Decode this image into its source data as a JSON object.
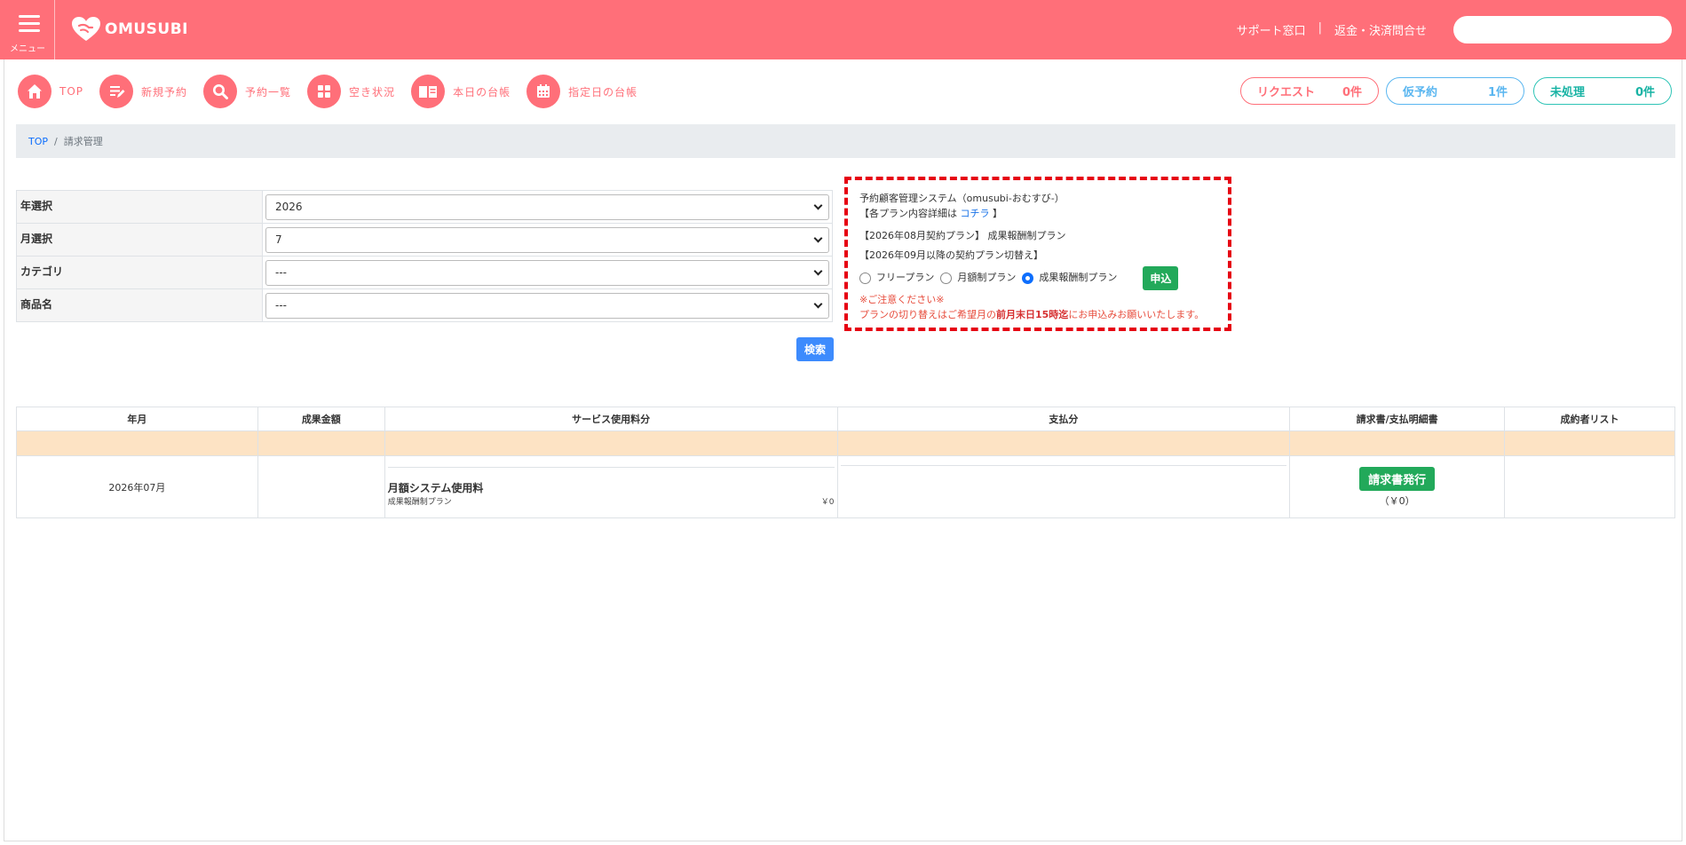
{
  "header": {
    "menu_label": "メニュー",
    "logo_text": "OMUSUBI",
    "support_link": "サポート窓口",
    "separator": "|",
    "refund_link": "返金・決済問合せ",
    "search_placeholder": ""
  },
  "nav": {
    "items": [
      {
        "label": "TOP",
        "icon": "home-icon"
      },
      {
        "label": "新規予約",
        "icon": "edit-list-icon"
      },
      {
        "label": "予約一覧",
        "icon": "search-icon"
      },
      {
        "label": "空き状況",
        "icon": "grid-icon"
      },
      {
        "label": "本日の台帳",
        "icon": "book-icon"
      },
      {
        "label": "指定日の台帳",
        "icon": "calendar-icon"
      }
    ]
  },
  "status": {
    "request": {
      "label": "リクエスト",
      "count": "0件",
      "color": "#ff6f79"
    },
    "provisional": {
      "label": "仮予約",
      "count": "1件",
      "color": "#5ab6f0"
    },
    "unprocessed": {
      "label": "未処理",
      "count": "0件",
      "color": "#18b3a4"
    }
  },
  "breadcrumb": {
    "home": "TOP",
    "sep": "/",
    "current": "請求管理"
  },
  "filter": {
    "year": {
      "label": "年選択",
      "value": "2026"
    },
    "month": {
      "label": "月選択",
      "value": "7"
    },
    "category": {
      "label": "カテゴリ",
      "value": "---"
    },
    "product": {
      "label": "商品名",
      "value": "---"
    },
    "search_button": "検索"
  },
  "plan": {
    "system_name": "予約顧客管理システム（omusubi-おむすび-）",
    "details_prefix": "【各プラン内容詳細は",
    "details_link": "コチラ",
    "details_suffix": "】",
    "current_contract": "【2026年08月契約プラン】 成果報酬制プラン",
    "switch_heading": "【2026年09月以降の契約プラン切替え】",
    "options": [
      {
        "label": "フリープラン",
        "selected": false
      },
      {
        "label": "月額制プラン",
        "selected": false
      },
      {
        "label": "成果報酬制プラン",
        "selected": true
      }
    ],
    "apply_button": "申込",
    "notice_title": "※ご注意ください※",
    "notice_pre": "プランの切り替えはご希望月の",
    "notice_bold": "前月末日15時迄",
    "notice_post": "にお申込みお願いいたします。"
  },
  "results": {
    "headers": [
      "年月",
      "成果金額",
      "サービス使用料分",
      "支払分",
      "請求書/支払明細書",
      "成約者リスト"
    ],
    "row": {
      "month": "2026年07月",
      "service_title": "月額システム使用料",
      "service_plan": "成果報酬制プラン",
      "service_amount": "￥0",
      "invoice_button": "請求書発行",
      "invoice_amount": "（￥0）"
    }
  },
  "colors": {
    "brand": "#ff6f79",
    "primary": "#3d8bfd",
    "success": "#22a95a",
    "highlight_row": "#fde3c4",
    "warning": "#e60012"
  }
}
